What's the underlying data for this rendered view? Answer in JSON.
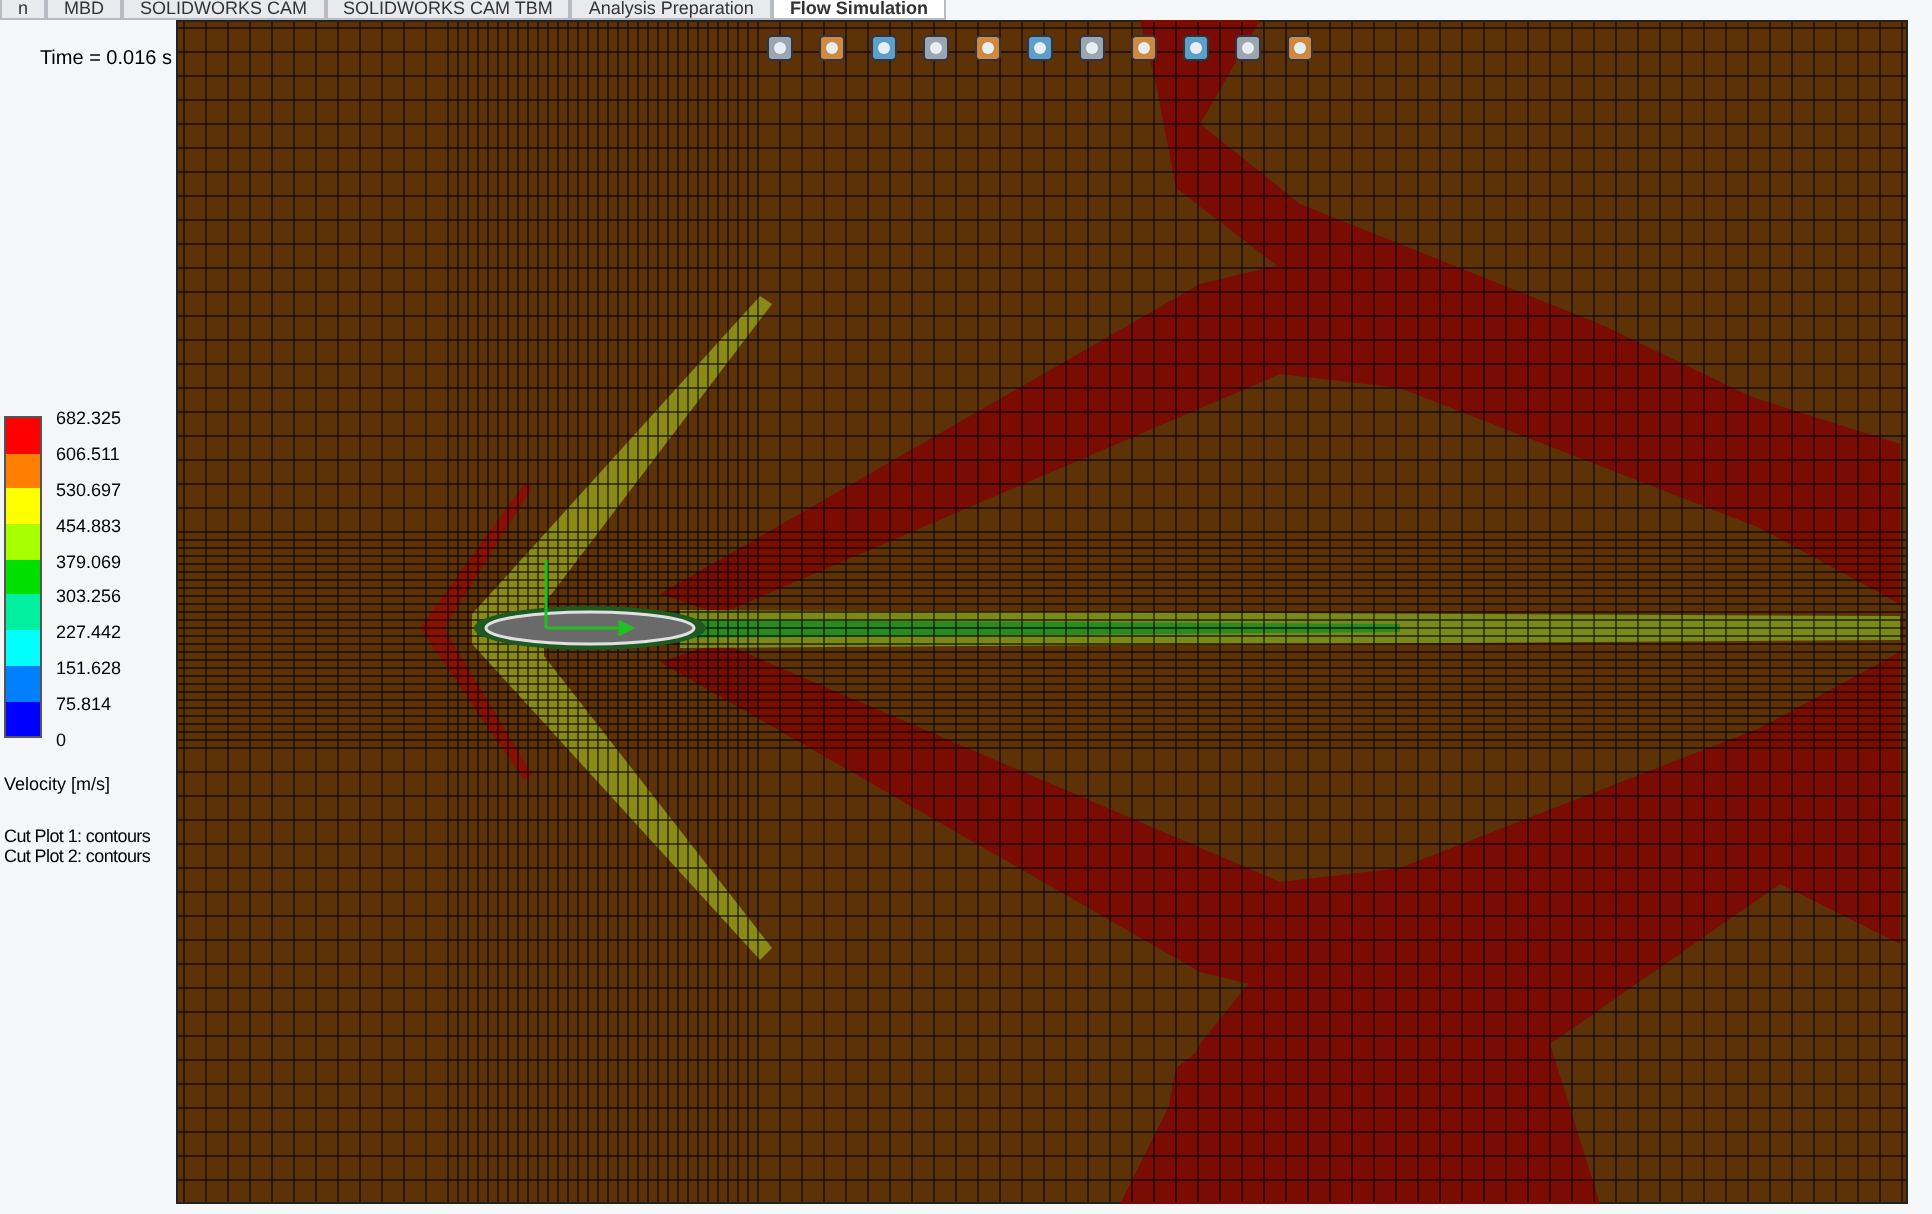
{
  "tabs": [
    {
      "label": "n",
      "selected": false
    },
    {
      "label": "MBD",
      "selected": false
    },
    {
      "label": "SOLIDWORKS CAM",
      "selected": false
    },
    {
      "label": "SOLIDWORKS CAM TBM",
      "selected": false
    },
    {
      "label": "Analysis Preparation",
      "selected": false
    },
    {
      "label": "Flow Simulation",
      "selected": true
    }
  ],
  "time_label": "Time = 0.016 s",
  "legend": {
    "ticks": [
      "682.325",
      "606.511",
      "530.697",
      "454.883",
      "379.069",
      "303.256",
      "227.442",
      "151.628",
      "75.814",
      "0"
    ],
    "bands": [
      {
        "color": "#ff0000"
      },
      {
        "color": "#ff8000"
      },
      {
        "color": "#ffff00"
      },
      {
        "color": "#a8ff00"
      },
      {
        "color": "#00e000"
      },
      {
        "color": "#00f0a0"
      },
      {
        "color": "#00ffff"
      },
      {
        "color": "#0080ff"
      },
      {
        "color": "#0000ff"
      }
    ],
    "title": "Velocity [m/s]"
  },
  "cut_plots": [
    "Cut Plot 1: contours",
    "Cut Plot 2: contours"
  ]
}
